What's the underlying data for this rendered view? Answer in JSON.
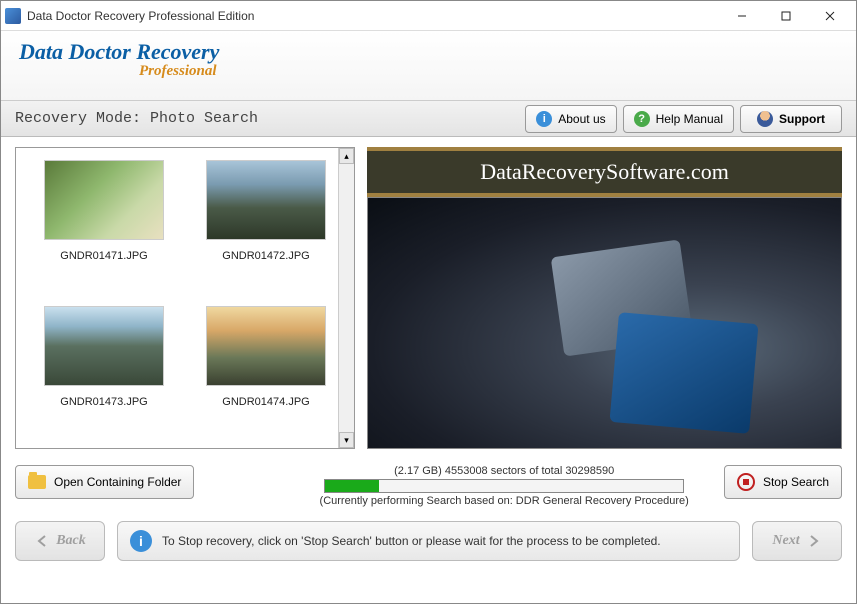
{
  "window": {
    "title": "Data Doctor Recovery Professional Edition"
  },
  "header": {
    "brand_main": "Data Doctor Recovery",
    "brand_sub": "Professional"
  },
  "modebar": {
    "label": "Recovery Mode: Photo Search",
    "about": "About us",
    "help": "Help Manual",
    "support": "Support"
  },
  "thumbs": [
    {
      "name": "GNDR01471.JPG"
    },
    {
      "name": "GNDR01472.JPG"
    },
    {
      "name": "GNDR01473.JPG"
    },
    {
      "name": "GNDR01474.JPG"
    }
  ],
  "promo": {
    "banner": "DataRecoverySoftware.com"
  },
  "progress": {
    "open_folder": "Open Containing Folder",
    "sectors_line": "(2.17 GB) 4553008  sectors  of  total 30298590",
    "percent": 15,
    "note": "(Currently performing Search based on:  DDR General Recovery Procedure)",
    "stop": "Stop Search"
  },
  "footer": {
    "back": "Back",
    "next": "Next",
    "hint": "To Stop recovery, click on 'Stop Search' button or please wait for the process to be completed."
  }
}
